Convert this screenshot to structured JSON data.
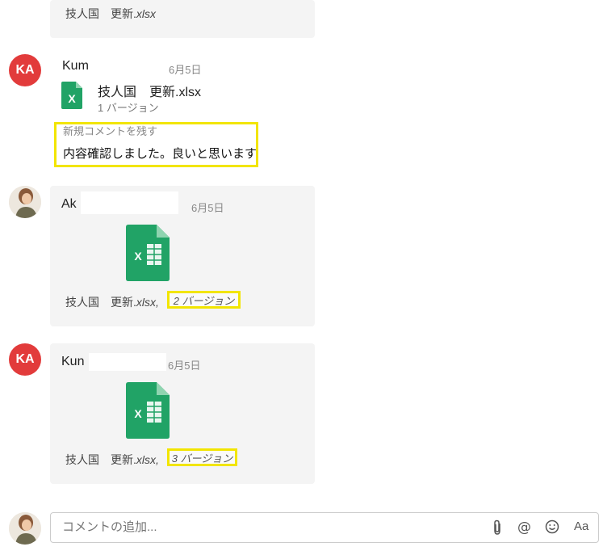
{
  "top_card": {
    "file_name_prefix": "技人国　更新.",
    "file_ext": "xlsx"
  },
  "messages": [
    {
      "avatar_initials": "KA",
      "author": "Kum",
      "date": "6月5日",
      "file_name": "技人国　更新.xlsx",
      "version_text": "1 バージョン",
      "comment_label": "新規コメントを残す",
      "comment_text": "内容確認しました。良いと思います"
    },
    {
      "author": "Ak",
      "date": "6月5日",
      "file_name_prefix": "技人国　更新.",
      "file_ext": "xlsx,",
      "version_text": "2 バージョン"
    },
    {
      "avatar_initials": "KA",
      "author": "Kun",
      "date": "6月5日",
      "file_name_prefix": "技人国　更新.",
      "file_ext": "xlsx,",
      "version_text": "3 バージョン"
    }
  ],
  "composer": {
    "placeholder": "コメントの追加...",
    "attach_icon": "paperclip-icon",
    "mention_icon": "at-icon",
    "emoji_icon": "smiley-icon",
    "format_label": "Aa"
  },
  "colors": {
    "highlight": "#f2e500",
    "avatar_red": "#e23b3b",
    "excel_green": "#21a366"
  }
}
